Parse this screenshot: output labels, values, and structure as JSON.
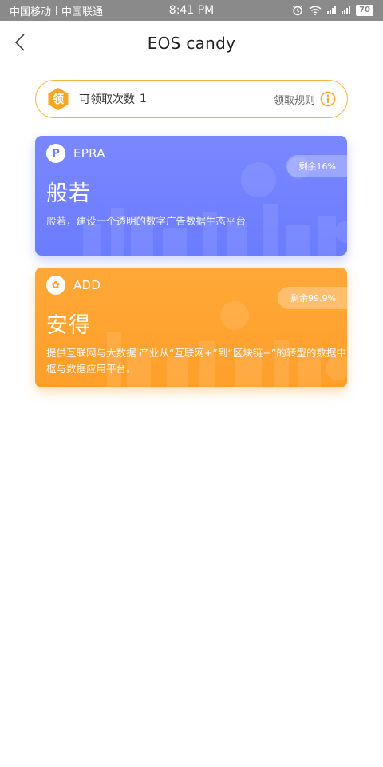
{
  "status_bar": {
    "carrier1": "中国移动",
    "carrier2": "中国联通",
    "time": "8:41 PM",
    "battery": "70"
  },
  "nav": {
    "title": "EOS candy"
  },
  "claim": {
    "badge": "领",
    "label": "可领取次数",
    "count": "1",
    "rules_label": "领取规则"
  },
  "tokens": [
    {
      "symbol": "EPRA",
      "coin_glyph": "P",
      "name": "般若",
      "remaining": "剩余16%",
      "description": "般若，建设一个透明的数字广告数据生态平台",
      "color": "#6b7cff"
    },
    {
      "symbol": "ADD",
      "coin_glyph": "✿",
      "name": "安得",
      "remaining": "剩余99.9%",
      "description": "提供互联网与大数据 产业从“互联网+”到“区块链+”的转型的数据中枢与数据应用平台。",
      "color": "#ff9f2a"
    }
  ],
  "colors": {
    "accent": "#f5b547",
    "epra_card": "#6b7cff",
    "add_card": "#ff9f2a"
  }
}
